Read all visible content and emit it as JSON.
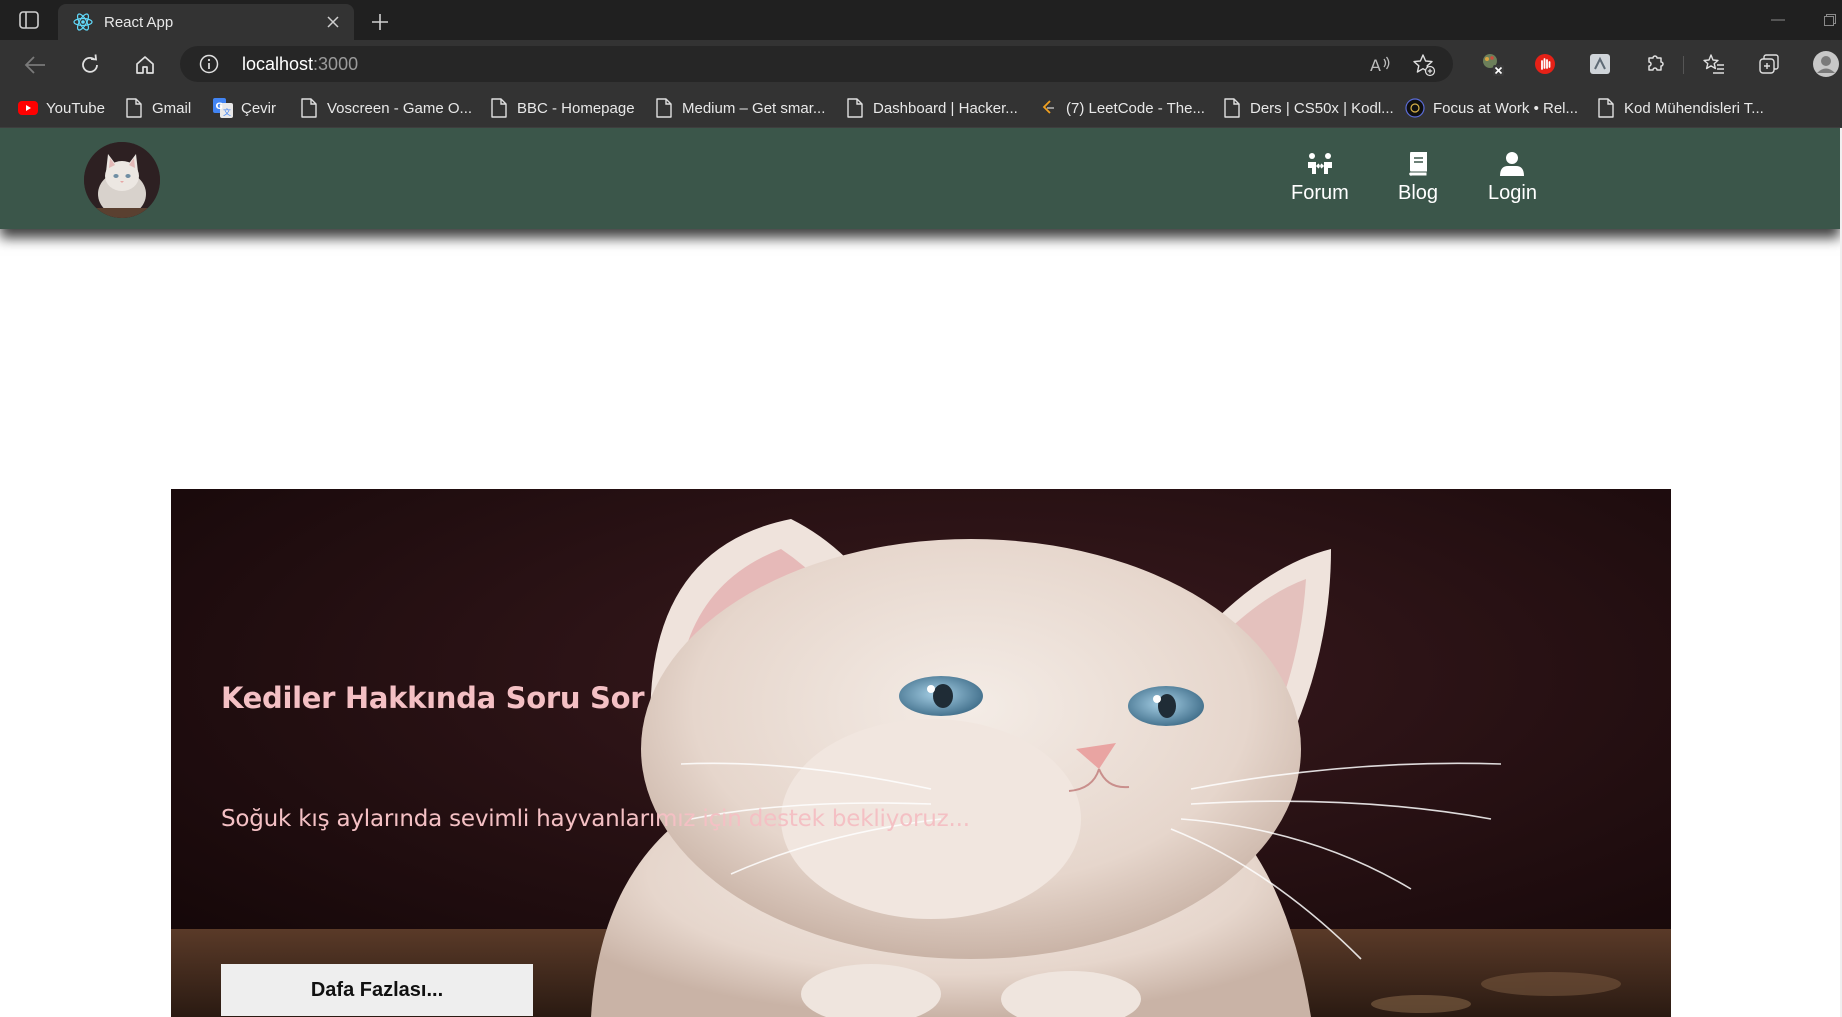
{
  "browser": {
    "tab_title": "React App",
    "url_host": "localhost",
    "url_port": ":3000",
    "bookmarks": [
      {
        "label": "YouTube",
        "icon": "youtube-icon"
      },
      {
        "label": "Gmail",
        "icon": "page-icon"
      },
      {
        "label": "Çevir",
        "icon": "translate-icon"
      },
      {
        "label": "Voscreen - Game O...",
        "icon": "page-icon"
      },
      {
        "label": "BBC - Homepage",
        "icon": "page-icon"
      },
      {
        "label": "Medium – Get smar...",
        "icon": "page-icon"
      },
      {
        "label": "Dashboard | Hacker...",
        "icon": "page-icon"
      },
      {
        "label": "(7) LeetCode - The...",
        "icon": "leetcode-icon"
      },
      {
        "label": "Ders | CS50x | Kodl...",
        "icon": "page-icon"
      },
      {
        "label": "Focus at Work • Rel...",
        "icon": "focus-icon"
      },
      {
        "label": "Kod Mühendisleri T...",
        "icon": "page-icon"
      }
    ]
  },
  "navbar": {
    "links": [
      {
        "label": "Forum",
        "icon": "people-arrows-icon"
      },
      {
        "label": "Blog",
        "icon": "book-icon"
      },
      {
        "label": "Login",
        "icon": "user-icon"
      }
    ],
    "color": "#3b564a"
  },
  "hero": {
    "title": "Kediler Hakkında Soru Sor",
    "subtitle": "Soğuk kış aylarında sevimli hayvanlarımız için destek bekliyoruz...",
    "button_label": "Dafa Fazlası...",
    "text_color": "#f4c0c4"
  }
}
